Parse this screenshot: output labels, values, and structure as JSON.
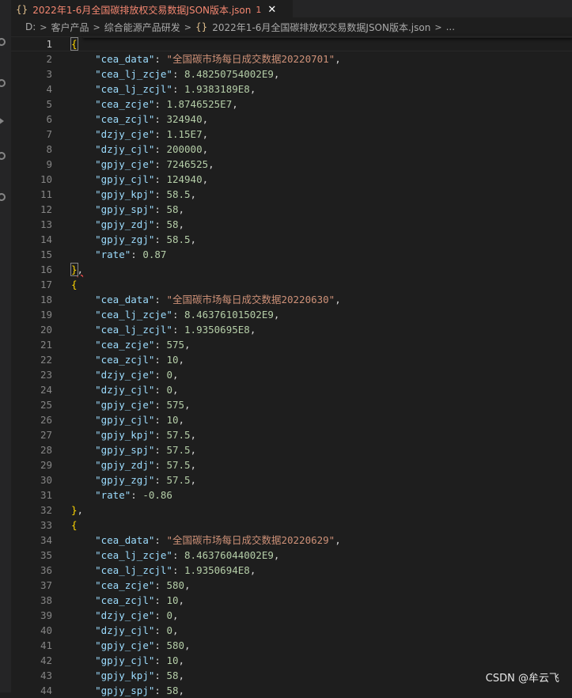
{
  "tab": {
    "icon": "{}",
    "title": "2022年1-6月全国碳排放权交易数据JSON版本.json",
    "modified": "1",
    "close": "✕"
  },
  "breadcrumb": {
    "items": [
      "D:",
      "客户产品",
      "综合能源产品研发",
      "2022年1-6月全国碳排放权交易数据JSON版本.json",
      "..."
    ],
    "separator": ">",
    "file_icon": "{}"
  },
  "editor": {
    "lines": [
      {
        "n": "1",
        "type": "open"
      },
      {
        "n": "2",
        "key": "cea_data",
        "val": "全国碳市场每日成交数据20220701",
        "vt": "s"
      },
      {
        "n": "3",
        "key": "cea_lj_zcje",
        "val": "8.48250754002E9",
        "vt": "n"
      },
      {
        "n": "4",
        "key": "cea_lj_zcjl",
        "val": "1.9383189E8",
        "vt": "n"
      },
      {
        "n": "5",
        "key": "cea_zcje",
        "val": "1.8746525E7",
        "vt": "n"
      },
      {
        "n": "6",
        "key": "cea_zcjl",
        "val": "324940",
        "vt": "n"
      },
      {
        "n": "7",
        "key": "dzjy_cje",
        "val": "1.15E7",
        "vt": "n"
      },
      {
        "n": "8",
        "key": "dzjy_cjl",
        "val": "200000",
        "vt": "n"
      },
      {
        "n": "9",
        "key": "gpjy_cje",
        "val": "7246525",
        "vt": "n"
      },
      {
        "n": "10",
        "key": "gpjy_cjl",
        "val": "124940",
        "vt": "n"
      },
      {
        "n": "11",
        "key": "gpjy_kpj",
        "val": "58.5",
        "vt": "n"
      },
      {
        "n": "12",
        "key": "gpjy_spj",
        "val": "58",
        "vt": "n"
      },
      {
        "n": "13",
        "key": "gpjy_zdj",
        "val": "58",
        "vt": "n"
      },
      {
        "n": "14",
        "key": "gpjy_zgj",
        "val": "58.5",
        "vt": "n"
      },
      {
        "n": "15",
        "key": "rate",
        "val": "0.87",
        "vt": "n",
        "last": true
      },
      {
        "n": "16",
        "type": "close_sq"
      },
      {
        "n": "17",
        "type": "open2"
      },
      {
        "n": "18",
        "key": "cea_data",
        "val": "全国碳市场每日成交数据20220630",
        "vt": "s"
      },
      {
        "n": "19",
        "key": "cea_lj_zcje",
        "val": "8.46376101502E9",
        "vt": "n"
      },
      {
        "n": "20",
        "key": "cea_lj_zcjl",
        "val": "1.9350695E8",
        "vt": "n"
      },
      {
        "n": "21",
        "key": "cea_zcje",
        "val": "575",
        "vt": "n"
      },
      {
        "n": "22",
        "key": "cea_zcjl",
        "val": "10",
        "vt": "n"
      },
      {
        "n": "23",
        "key": "dzjy_cje",
        "val": "0",
        "vt": "n"
      },
      {
        "n": "24",
        "key": "dzjy_cjl",
        "val": "0",
        "vt": "n"
      },
      {
        "n": "25",
        "key": "gpjy_cje",
        "val": "575",
        "vt": "n"
      },
      {
        "n": "26",
        "key": "gpjy_cjl",
        "val": "10",
        "vt": "n"
      },
      {
        "n": "27",
        "key": "gpjy_kpj",
        "val": "57.5",
        "vt": "n"
      },
      {
        "n": "28",
        "key": "gpjy_spj",
        "val": "57.5",
        "vt": "n"
      },
      {
        "n": "29",
        "key": "gpjy_zdj",
        "val": "57.5",
        "vt": "n"
      },
      {
        "n": "30",
        "key": "gpjy_zgj",
        "val": "57.5",
        "vt": "n"
      },
      {
        "n": "31",
        "key": "rate",
        "val": "-0.86",
        "vt": "n",
        "last": true
      },
      {
        "n": "32",
        "type": "close"
      },
      {
        "n": "33",
        "type": "open2"
      },
      {
        "n": "34",
        "key": "cea_data",
        "val": "全国碳市场每日成交数据20220629",
        "vt": "s"
      },
      {
        "n": "35",
        "key": "cea_lj_zcje",
        "val": "8.46376044002E9",
        "vt": "n"
      },
      {
        "n": "36",
        "key": "cea_lj_zcjl",
        "val": "1.9350694E8",
        "vt": "n"
      },
      {
        "n": "37",
        "key": "cea_zcje",
        "val": "580",
        "vt": "n"
      },
      {
        "n": "38",
        "key": "cea_zcjl",
        "val": "10",
        "vt": "n"
      },
      {
        "n": "39",
        "key": "dzjy_cje",
        "val": "0",
        "vt": "n"
      },
      {
        "n": "40",
        "key": "dzjy_cjl",
        "val": "0",
        "vt": "n"
      },
      {
        "n": "41",
        "key": "gpjy_cje",
        "val": "580",
        "vt": "n"
      },
      {
        "n": "42",
        "key": "gpjy_cjl",
        "val": "10",
        "vt": "n"
      },
      {
        "n": "43",
        "key": "gpjy_kpj",
        "val": "58",
        "vt": "n"
      },
      {
        "n": "44",
        "key": "gpjy_spj",
        "val": "58",
        "vt": "n"
      }
    ]
  },
  "watermark": "CSDN @牟云飞",
  "colors": {
    "background": "#1e1e1e",
    "key": "#9cdcfe",
    "string": "#ce9178",
    "number": "#b5cea8",
    "brace": "#ffd700",
    "line_number": "#858585",
    "tab_modified_text": "#f48771"
  }
}
